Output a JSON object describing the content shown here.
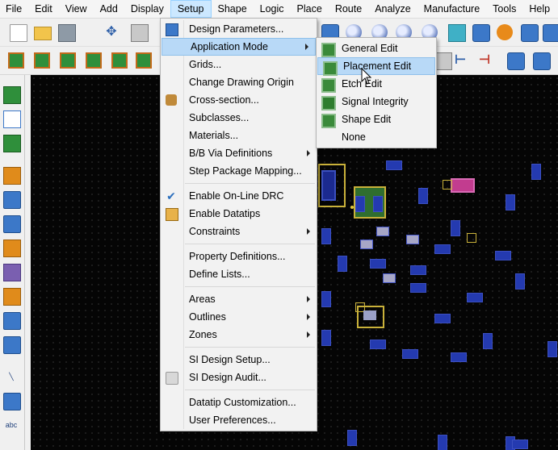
{
  "menubar": {
    "items": [
      "File",
      "Edit",
      "View",
      "Add",
      "Display",
      "Setup",
      "Shape",
      "Logic",
      "Place",
      "Route",
      "Analyze",
      "Manufacture",
      "Tools",
      "Help"
    ],
    "active": "Setup"
  },
  "setup_menu": {
    "items": [
      {
        "label": "Design Parameters...",
        "icon": "design-parameters-icon"
      },
      {
        "label": "Application Mode",
        "submenu": true,
        "highlighted": true
      },
      {
        "label": "Grids..."
      },
      {
        "label": "Change Drawing Origin"
      },
      {
        "label": "Cross-section...",
        "icon": "cross-section-icon"
      },
      {
        "label": "Subclasses..."
      },
      {
        "label": "Materials..."
      },
      {
        "label": "B/B Via Definitions",
        "submenu": true
      },
      {
        "label": "Step Package Mapping..."
      },
      {
        "label": "Enable On-Line DRC",
        "checked": true
      },
      {
        "label": "Enable Datatips",
        "icon": "datatip-icon"
      },
      {
        "label": "Constraints",
        "submenu": true
      },
      {
        "label": "Property Definitions..."
      },
      {
        "label": "Define Lists..."
      },
      {
        "label": "Areas",
        "submenu": true
      },
      {
        "label": "Outlines",
        "submenu": true
      },
      {
        "label": "Zones",
        "submenu": true
      },
      {
        "label": "SI Design Setup..."
      },
      {
        "label": "SI Design Audit...",
        "icon": "si-audit-icon"
      },
      {
        "label": "Datatip Customization..."
      },
      {
        "label": "User Preferences..."
      }
    ]
  },
  "application_mode_submenu": {
    "items": [
      {
        "label": "General Edit"
      },
      {
        "label": "Placement Edit",
        "highlighted": true
      },
      {
        "label": "Etch Edit"
      },
      {
        "label": "Signal Integrity"
      },
      {
        "label": "Shape Edit"
      },
      {
        "label": "None"
      }
    ]
  },
  "colors": {
    "menu_highlight": "#b8d9f7",
    "canvas_background": "#050505",
    "check_mark": "#2b6fbd"
  }
}
